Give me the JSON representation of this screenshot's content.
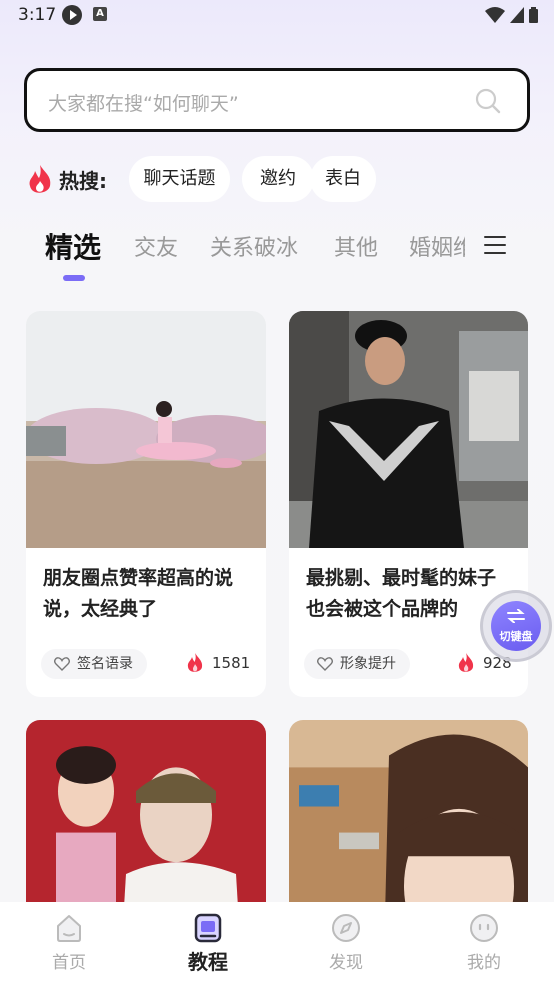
{
  "status_bar": {
    "time": "3:17"
  },
  "search": {
    "placeholder": "大家都在搜“如何聊天”"
  },
  "hot_search": {
    "label": "热搜:",
    "chips": [
      "聊天话题",
      "邀约",
      "表白"
    ]
  },
  "tabs": [
    "精选",
    "交友",
    "关系破冰",
    "其他",
    "婚姻维"
  ],
  "cards": [
    {
      "title": "朋友圈点赞率超高的说说，太经典了",
      "tag": "签名语录",
      "likes": "1581"
    },
    {
      "title": "最挑剔、最时髦的妹子也会被这个品牌的",
      "tag": "形象提升",
      "likes": "928"
    }
  ],
  "float_button": {
    "label": "切键盘"
  },
  "bottom_nav": [
    {
      "label": "首页",
      "icon": "home-icon"
    },
    {
      "label": "教程",
      "icon": "tutorial-icon"
    },
    {
      "label": "发现",
      "icon": "compass-icon"
    },
    {
      "label": "我的",
      "icon": "profile-icon"
    }
  ],
  "colors": {
    "accent": "#7b6cf6",
    "fire": "#f0344a"
  }
}
